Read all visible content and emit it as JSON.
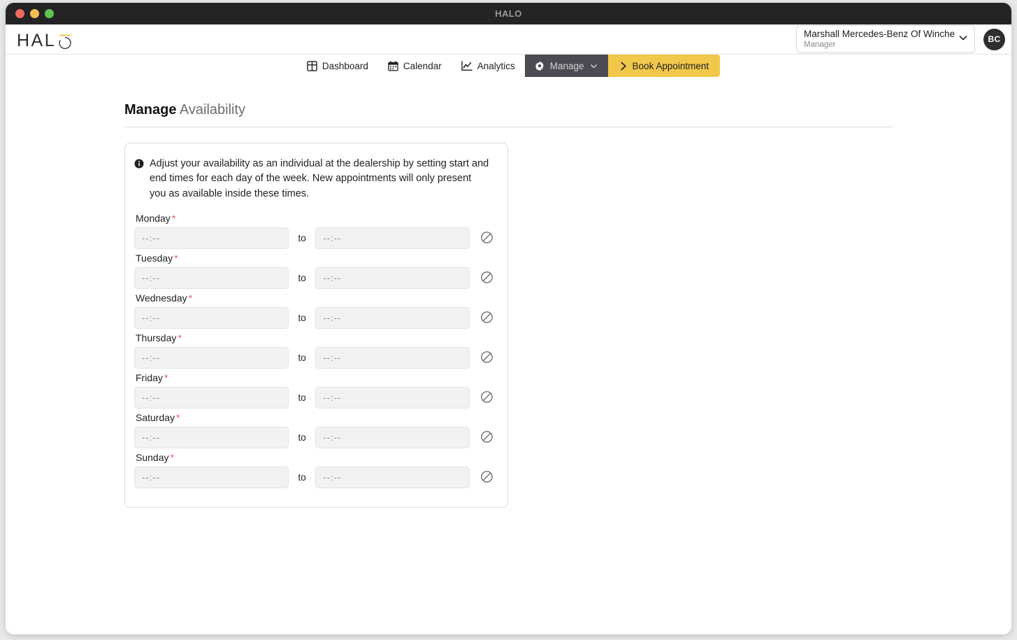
{
  "window": {
    "title": "HALO",
    "traffic_lights": [
      "close-red",
      "minimize-yellow",
      "zoom-green"
    ]
  },
  "header": {
    "logo_text": "HAL",
    "logo_icon": "halo-o-ring-icon",
    "dealer": {
      "name": "Marshall Mercedes-Benz Of Winchester",
      "role": "Manager",
      "chevron": "chevron-down-icon"
    },
    "avatar_initials": "BC"
  },
  "nav": {
    "items": [
      {
        "label": "Dashboard",
        "icon": "grid-icon",
        "state": "default"
      },
      {
        "label": "Calendar",
        "icon": "calendar-icon",
        "state": "default"
      },
      {
        "label": "Analytics",
        "icon": "line-chart-icon",
        "state": "default"
      },
      {
        "label": "Manage",
        "icon": "gear-icon",
        "state": "active",
        "caret": "chevron-down-icon"
      },
      {
        "label": "Book Appointment",
        "icon": "chevron-right-icon",
        "state": "cta"
      }
    ]
  },
  "page": {
    "title_bold": "Manage",
    "title_light": "Availability"
  },
  "card": {
    "info_icon": "info-circle-icon",
    "info_text": "Adjust your availability as an individual at the dealership by setting start and end times for each day of the week. New appointments will only present you as available inside these times.",
    "to_label": "to",
    "time_placeholder": "--:--",
    "clear_icon": "prohibition-circle-slash-icon",
    "required_marker": "*",
    "days": [
      {
        "label": "Monday",
        "start": "",
        "end": ""
      },
      {
        "label": "Tuesday",
        "start": "",
        "end": ""
      },
      {
        "label": "Wednesday",
        "start": "",
        "end": ""
      },
      {
        "label": "Thursday",
        "start": "",
        "end": ""
      },
      {
        "label": "Friday",
        "start": "",
        "end": ""
      },
      {
        "label": "Saturday",
        "start": "",
        "end": ""
      },
      {
        "label": "Sunday",
        "start": "",
        "end": ""
      }
    ]
  },
  "colors": {
    "titlebar": "#242424",
    "accent_gold": "#f2c84b",
    "active_tab": "#4b4b53",
    "required_red": "#e8635a",
    "input_bg": "#f2f2f2"
  }
}
